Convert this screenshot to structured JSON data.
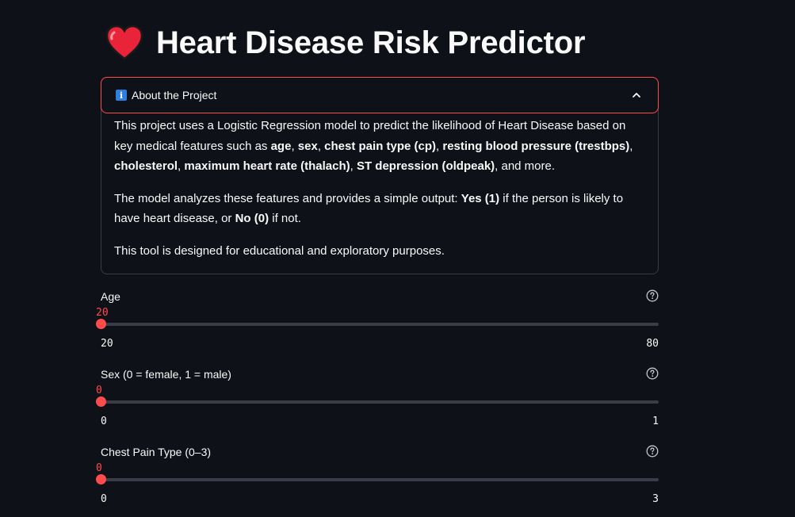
{
  "page": {
    "title": "Heart Disease Risk Predictor"
  },
  "expander": {
    "title": "About the Project",
    "expanded": true,
    "paragraphs": [
      [
        {
          "t": "This project uses a Logistic Regression model to predict the likelihood of Heart Disease based on key medical features such as ",
          "b": false
        },
        {
          "t": "age",
          "b": true
        },
        {
          "t": ", ",
          "b": false
        },
        {
          "t": "sex",
          "b": true
        },
        {
          "t": ", ",
          "b": false
        },
        {
          "t": "chest pain type (cp)",
          "b": true
        },
        {
          "t": ", ",
          "b": false
        },
        {
          "t": "resting blood pressure (trestbps)",
          "b": true
        },
        {
          "t": ", ",
          "b": false
        },
        {
          "t": "cholesterol",
          "b": true
        },
        {
          "t": ", ",
          "b": false
        },
        {
          "t": "maximum heart rate (thalach)",
          "b": true
        },
        {
          "t": ", ",
          "b": false
        },
        {
          "t": "ST depression (oldpeak)",
          "b": true
        },
        {
          "t": ", and more.",
          "b": false
        }
      ],
      [
        {
          "t": "The model analyzes these features and provides a simple output: ",
          "b": false
        },
        {
          "t": "Yes (1)",
          "b": true
        },
        {
          "t": " if the person is likely to have heart disease, or ",
          "b": false
        },
        {
          "t": "No (0)",
          "b": true
        },
        {
          "t": " if not.",
          "b": false
        }
      ],
      [
        {
          "t": "This tool is designed for educational and exploratory purposes.",
          "b": false
        }
      ]
    ]
  },
  "sliders": [
    {
      "label": "Age",
      "value": "20",
      "min": "20",
      "max": "80",
      "fraction": 0.0
    },
    {
      "label": "Sex (0 = female, 1 = male)",
      "value": "0",
      "min": "0",
      "max": "1",
      "fraction": 0.0
    },
    {
      "label": "Chest Pain Type (0–3)",
      "value": "0",
      "min": "0",
      "max": "3",
      "fraction": 0.0
    }
  ],
  "colors": {
    "accent": "#ff4b4b",
    "background": "#0e1117",
    "text": "#fafafa",
    "border": "#3a3d47",
    "info_icon": "#2f7fe0"
  },
  "icons": {
    "title_icon": "heart-icon",
    "expander_icon": "info-icon",
    "expander_toggle": "chevron-up-icon",
    "slider_help": "help-icon"
  }
}
